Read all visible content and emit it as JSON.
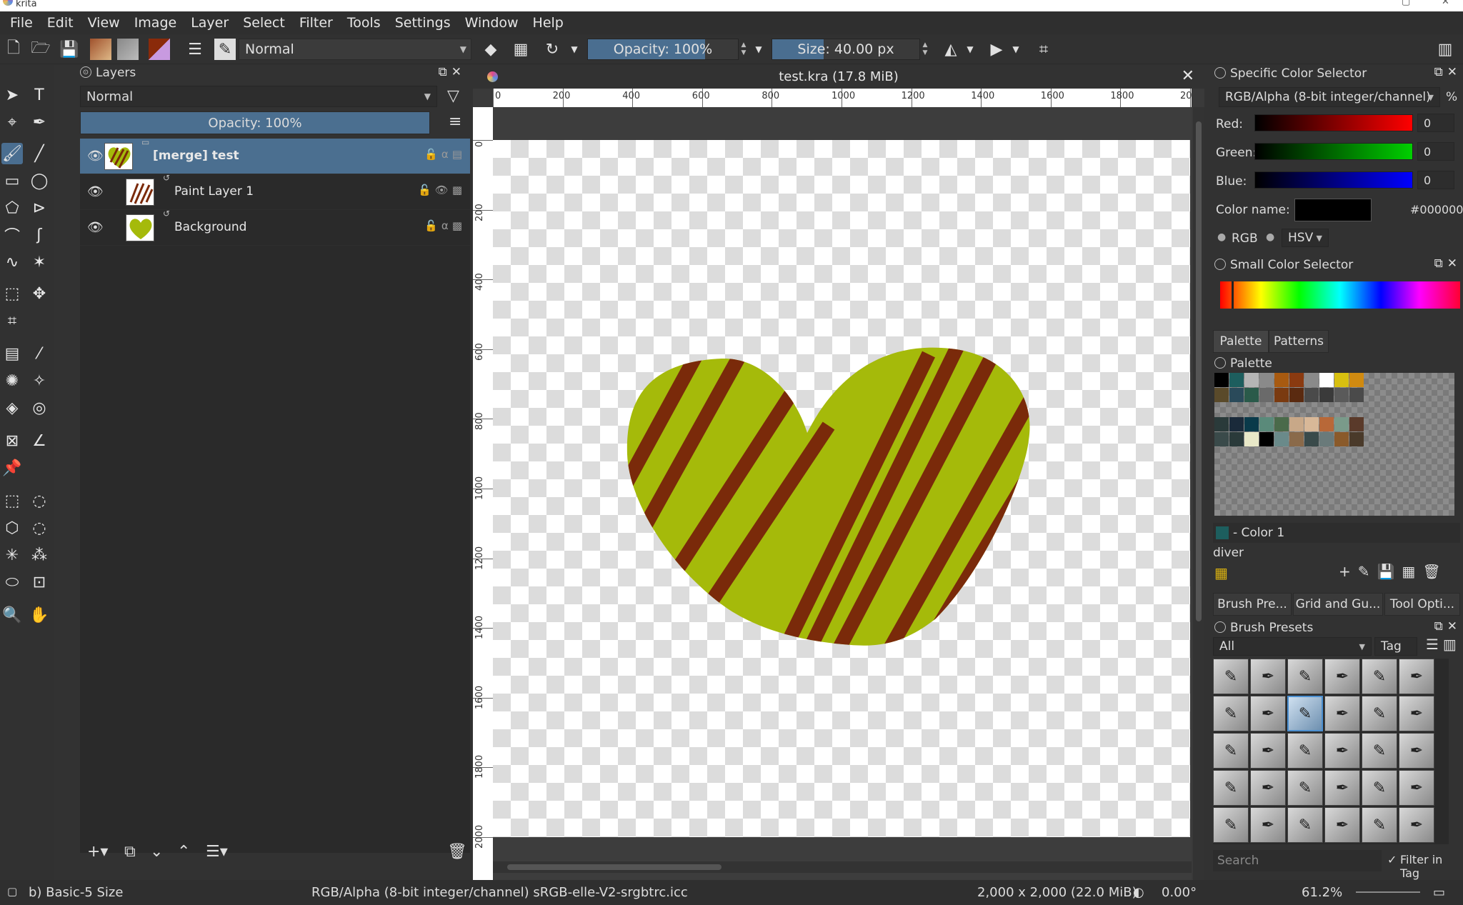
{
  "window": {
    "title": "krita"
  },
  "menubar": [
    "File",
    "Edit",
    "View",
    "Image",
    "Layer",
    "Select",
    "Filter",
    "Tools",
    "Settings",
    "Window",
    "Help"
  ],
  "toolbar": {
    "blend_mode": "Normal",
    "opacity": "Opacity: 100%",
    "opacity_fraction": 0.78,
    "size": "Size: 40.00 px",
    "size_fraction": 0.35
  },
  "layers_docker": {
    "title": "Layers",
    "blend_mode": "Normal",
    "opacity": "Opacity:  100%",
    "layers": [
      {
        "name": "[merge] test",
        "selected": true
      },
      {
        "name": "Paint Layer 1",
        "selected": false
      },
      {
        "name": "Background",
        "selected": false
      }
    ]
  },
  "document": {
    "tab_title": "test.kra (17.8 MiB)",
    "h_ruler": [
      "0",
      "200",
      "400",
      "600",
      "800",
      "1000",
      "1200",
      "1400",
      "1600",
      "1800",
      "2000"
    ],
    "v_ruler": [
      "0",
      "200",
      "400",
      "600",
      "800",
      "1000",
      "1200",
      "1400",
      "1600",
      "1800",
      "2000"
    ],
    "heart_fill": "#a5ba0a",
    "stripe_color": "#7a2a0a"
  },
  "color_selector": {
    "title": "Specific Color Selector",
    "model": "RGB/Alpha (8-bit integer/channel)",
    "percent": "%",
    "channels": [
      {
        "label": "Red:",
        "value": "0",
        "color": "#ff0000"
      },
      {
        "label": "Green:",
        "value": "0",
        "color": "#00d000"
      },
      {
        "label": "Blue:",
        "value": "0",
        "color": "#0000ff"
      }
    ],
    "color_name_label": "Color name:",
    "hex": "#000000",
    "rgb_label": "RGB",
    "hsv_label": "HSV"
  },
  "small_color_selector": {
    "title": "Small Color Selector"
  },
  "palette_tabs": [
    "Palette",
    "Patterns"
  ],
  "palette": {
    "title": "Palette",
    "current_color": "- Color 1",
    "palette_name": "diver",
    "swatches": [
      "#000000",
      "#1d5e5e",
      "#b5b5b5",
      "#8a8a8a",
      "#a85a10",
      "#8a3a10",
      "#8a8a8a",
      "#ffffff",
      "#d8c010",
      "#d08a10",
      "#5a4a2a",
      "#2a4a5a",
      "#2a5a4a",
      "#6a6a6a",
      "#7a3a10",
      "#5a2a10",
      "#4a4a4a",
      "#3a3a3a",
      "#5a5a5a",
      "#4a4a4a",
      "#2a3a3a",
      "#1a2a3a",
      "#0a3a4a",
      "#5a8a7a",
      "#4a6a4a",
      "#c8a888",
      "#d8b898",
      "#b86838",
      "#7a9a8a",
      "#5a3a2a",
      "#3a4a4a",
      "#2a3a3a",
      "#e8e8c8",
      "#000000",
      "#6a8a8a",
      "#8a6a4a",
      "#3a4a4a",
      "#6a7a7a",
      "#8a5a2a",
      "#4a3a2a"
    ]
  },
  "dock_tabs": [
    "Brush Pre...",
    "Grid and Gu...",
    "Tool Opti..."
  ],
  "brush_presets": {
    "title": "Brush Presets",
    "filter": "All",
    "tag_label": "Tag",
    "search_placeholder": "Search",
    "filter_in_tag": "Filter in Tag"
  },
  "statusbar": {
    "brush": "b) Basic-5 Size",
    "color_profile": "RGB/Alpha (8-bit integer/channel)  sRGB-elle-V2-srgbtrc.icc",
    "dimensions": "2,000 x 2,000 (22.0 MiB)",
    "rotation": "0.00°",
    "zoom": "61.2%"
  }
}
